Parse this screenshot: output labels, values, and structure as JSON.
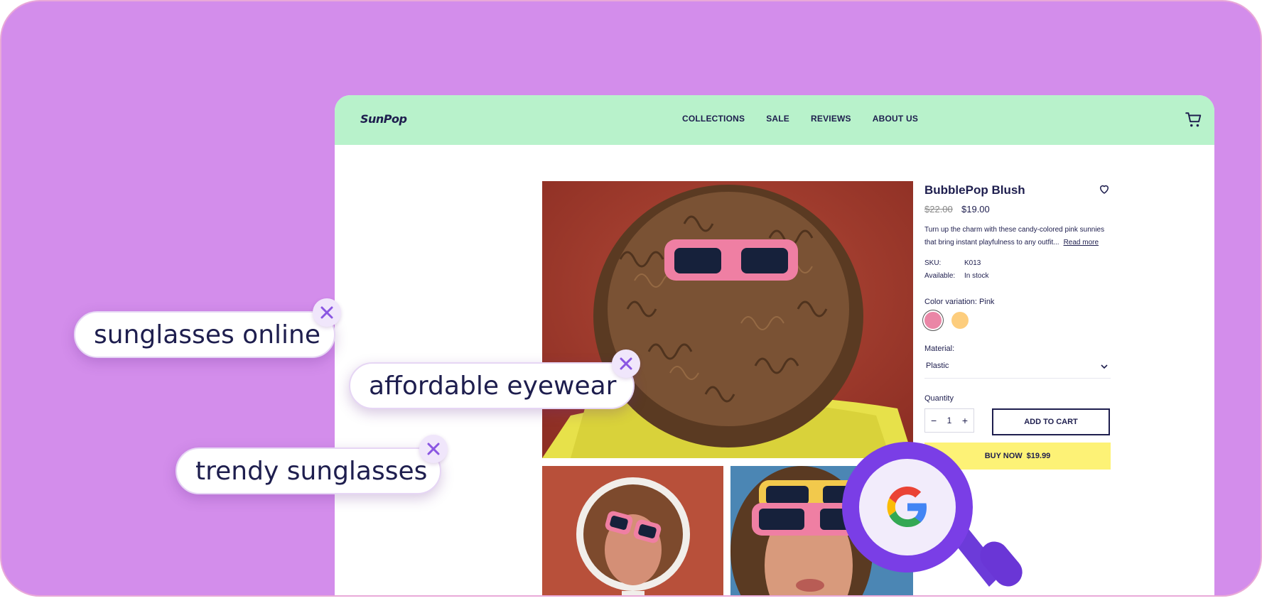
{
  "brand": {
    "logo": "SunPop"
  },
  "nav": {
    "items": [
      "COLLECTIONS",
      "SALE",
      "REVIEWS",
      "ABOUT US"
    ]
  },
  "product": {
    "title": "BubblePop Blush",
    "old_price": "$22.00",
    "new_price": "$19.00",
    "description": "Turn up the charm with these candy-colored pink sunnies that bring instant playfulness to any outfit...",
    "read_more": "Read more",
    "sku_label": "SKU:",
    "sku_value": "K013",
    "available_label": "Available:",
    "available_value": "In stock",
    "color_label": "Color variation: Pink",
    "colors": [
      {
        "name": "pink",
        "hex": "#ea86a6"
      },
      {
        "name": "yellow",
        "hex": "#fdcd7d"
      }
    ],
    "material_label": "Material:",
    "material_value": "Plastic",
    "quantity_label": "Quantity",
    "quantity_value": "1",
    "add_to_cart": "ADD TO CART",
    "buy_now_label": "BUY NOW",
    "buy_now_price": "$19.99"
  },
  "keywords": [
    "sunglasses online",
    "affordable eyewear",
    "trendy sunglasses"
  ],
  "colors": {
    "background": "#d38deb",
    "nav": "#b8f2cb",
    "text": "#1e1e4e",
    "buy_now": "#fdf276",
    "magnifier": "#7a3ee6"
  }
}
